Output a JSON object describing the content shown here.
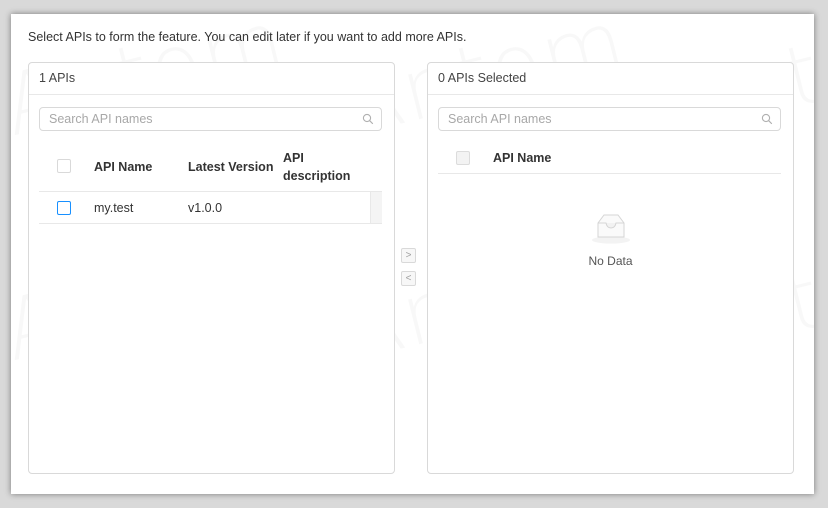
{
  "instruction": "Select APIs to form the feature. You can edit later if you want to add more APIs.",
  "source_panel": {
    "header": "1 APIs",
    "search_placeholder": "Search API names",
    "columns": [
      "API Name",
      "Latest Version",
      "API",
      "description"
    ],
    "rows": [
      {
        "api_name": "my.test",
        "latest_version": "v1.0.0",
        "description": ""
      }
    ]
  },
  "operations": {
    "move_right": ">",
    "move_left": "<"
  },
  "target_panel": {
    "header": "0 APIs Selected",
    "search_placeholder": "Search API names",
    "columns": [
      "API Name"
    ],
    "empty_text": "No Data"
  },
  "watermark": "Antom",
  "colors": {
    "accent": "#1890ff",
    "border": "#d9d9d9"
  }
}
